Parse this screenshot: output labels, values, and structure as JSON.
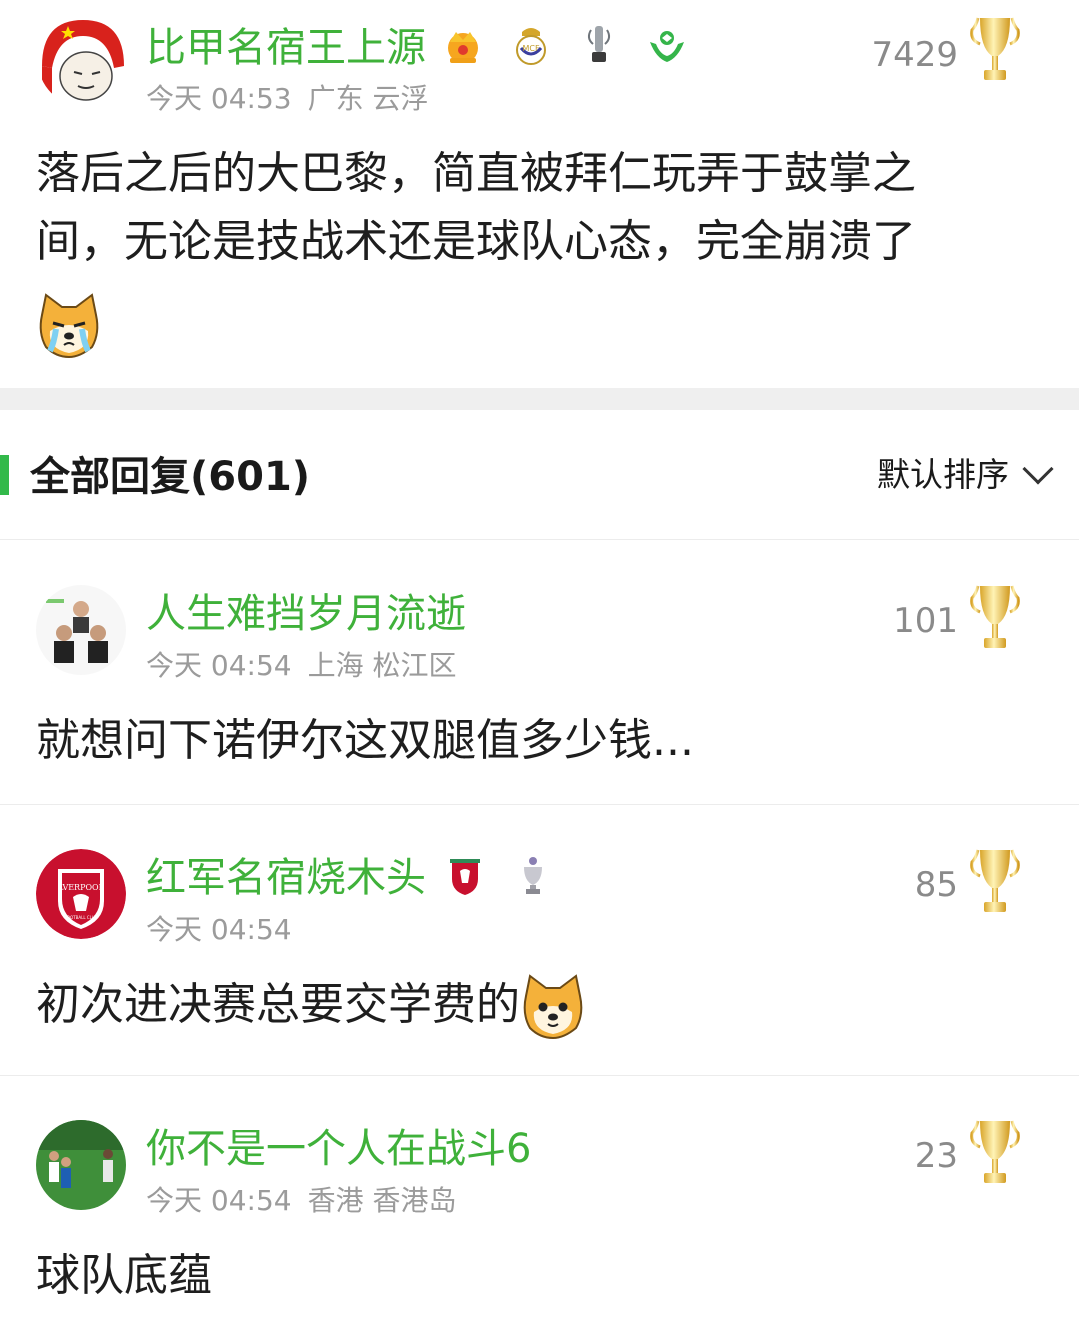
{
  "post": {
    "username": "比甲名宿王上源",
    "time": "今天 04:53",
    "location": "广东 云浮",
    "likes": "7429",
    "badges": [
      "crown-icon",
      "real-madrid-badge-icon",
      "silver-trophy-icon",
      "green-emblem-icon"
    ],
    "content_line1": "落后之后的大巴黎，简直被拜仁玩弄于鼓掌之",
    "content_line2": "间，无论是技战术还是球队心态，完全崩溃了",
    "content_emoji": "crying-doge-emoji"
  },
  "replies_section": {
    "title": "全部回复(601)",
    "sort_label": "默认排序"
  },
  "replies": [
    {
      "username": "人生难挡岁月流逝",
      "time": "今天 04:54",
      "location": "上海 松江区",
      "likes": "101",
      "content": "就想问下诺伊尔这双腿值多少钱..."
    },
    {
      "username": "红军名宿烧木头",
      "time": "今天 04:54",
      "location": "",
      "likes": "85",
      "content": "初次进决赛总要交学费的",
      "avatar_text_top": "LVERPOOL",
      "avatar_text_bottom": "FOOTBALL CLUB",
      "badges": [
        "liverpool-badge-icon",
        "premier-league-trophy-icon"
      ]
    },
    {
      "username": "你不是一个人在战斗6",
      "time": "今天 04:54",
      "location": "香港 香港岛",
      "likes": "23",
      "content": "球队底蕴"
    }
  ],
  "colors": {
    "username_green": "#3fb13a",
    "accent_bar": "#32b94a",
    "trophy_gold": "#f3c84a"
  }
}
